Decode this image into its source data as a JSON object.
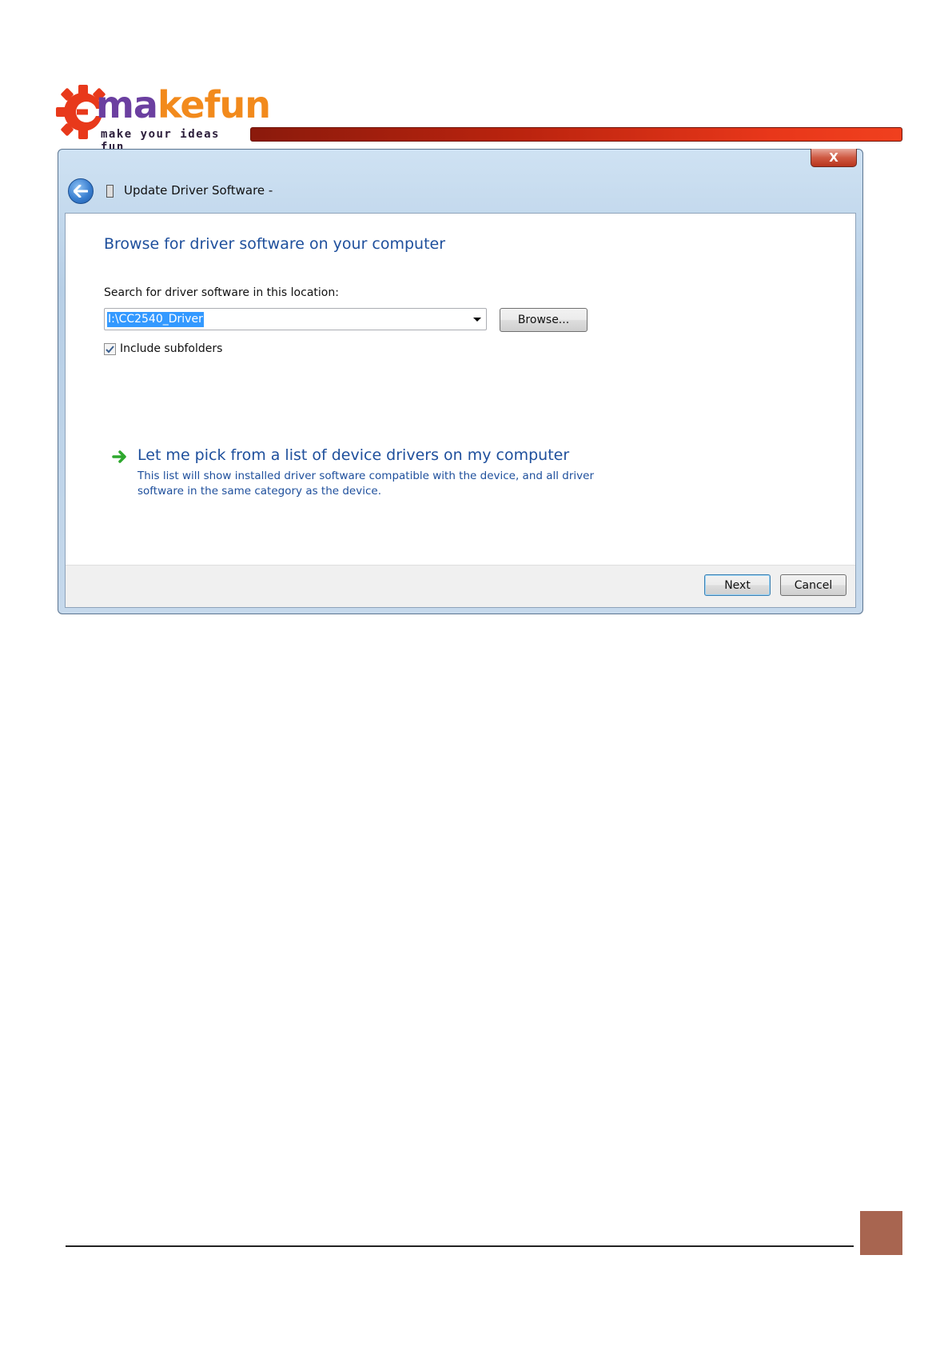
{
  "logo": {
    "brand_part1": "ma",
    "brand_part2": "kefun",
    "tagline": "make your ideas fun",
    "colors": {
      "gear": "#e8391b",
      "purple": "#6b3fa0",
      "orange": "#f28a1c"
    }
  },
  "window": {
    "close_label": "X",
    "nav_title": "Update Driver Software - ",
    "back_icon": "back-arrow-icon",
    "device_icon": "device-icon"
  },
  "content": {
    "heading": "Browse for driver software on your computer",
    "search_label": "Search for driver software in this location:",
    "path_value": "I:\\CC2540_Driver",
    "browse_label": "Browse...",
    "include_subfolders_label": "Include subfolders",
    "include_subfolders_checked": true,
    "pick_title": "Let me pick from a list of device drivers on my computer",
    "pick_description": "This list will show installed driver software compatible with the device, and all driver software in the same category as the device."
  },
  "footer": {
    "next_label": "Next",
    "cancel_label": "Cancel"
  },
  "colors": {
    "link_blue": "#1e4f9c",
    "selection_blue": "#3399ff",
    "header_bar": "#c8290f",
    "page_mark": "#a86550"
  }
}
